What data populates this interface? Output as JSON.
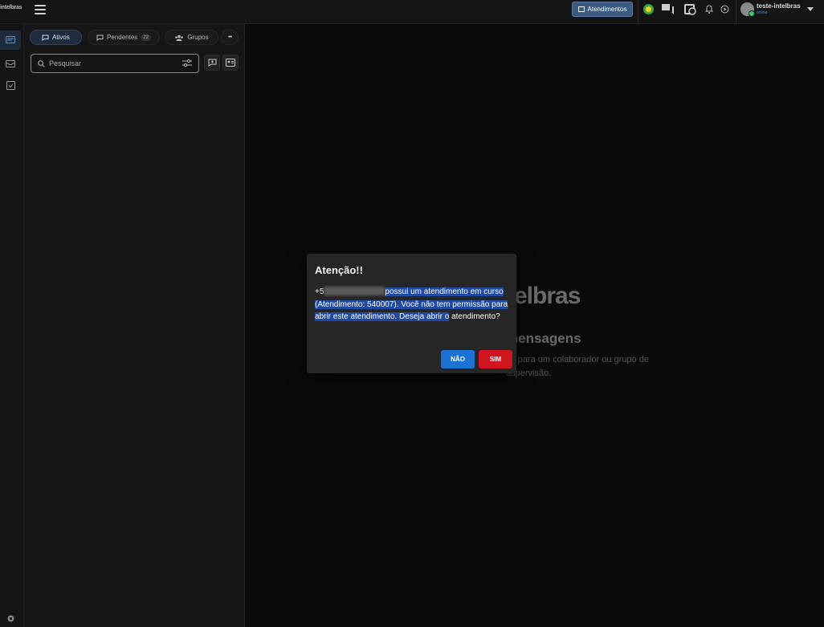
{
  "topbar": {
    "brand": "intelbras",
    "atendimentos_label": "Atendimentos",
    "user_name": "teste-intelbras",
    "user_status": "online"
  },
  "sidebar": {
    "tabs": [
      {
        "label": "Ativos",
        "active": true
      },
      {
        "label": "Pendentes",
        "count": "22"
      },
      {
        "label": "Grupos"
      }
    ],
    "more_label": "•••",
    "search_placeholder": "Pesquisar"
  },
  "main": {
    "brand_partial": "elbras",
    "title_partial": "mensagens",
    "subtitle_partial": "ns para um colaborador ou grupo de supervisão."
  },
  "dialog": {
    "title": "Atenção!!",
    "phone_prefix": "+5",
    "message_part1": "possui um atendimento em curso (Atendimento: 540007). Você não tem permissão para abrir este atendimento. Deseja abrir o",
    "message_part2": "atendimento?",
    "no_label": "NÃO",
    "yes_label": "SIM"
  },
  "colors": {
    "accent": "#1a73d4",
    "danger": "#d01420",
    "highlight": "#1e4aa6"
  }
}
